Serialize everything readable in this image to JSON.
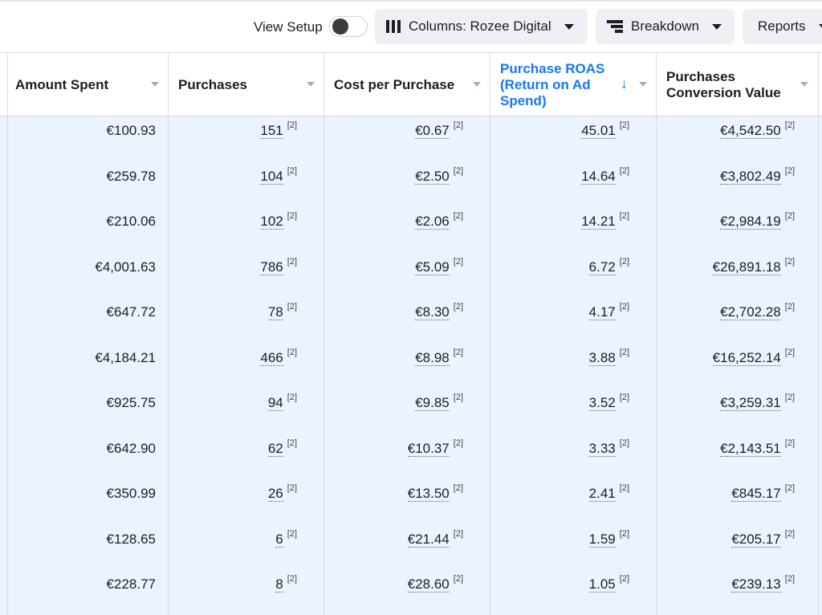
{
  "toolbar": {
    "view_setup_label": "View Setup",
    "view_setup_on": false,
    "columns_label": "Columns: Rozee Digital",
    "breakdown_label": "Breakdown",
    "reports_label": "Reports"
  },
  "table": {
    "columns": [
      {
        "label": "Amount Spent",
        "sorted": false
      },
      {
        "label": "Purchases",
        "sorted": false
      },
      {
        "label": "Cost per Purchase",
        "sorted": false
      },
      {
        "label": "Purchase ROAS (Return on Ad Spend)",
        "sorted": true,
        "sort_direction": "descending"
      },
      {
        "label": "Purchases Conversion Value",
        "sorted": false
      }
    ],
    "footnote": "[2]",
    "rows": [
      {
        "amount_spent": "€100.93",
        "purchases": "151",
        "cost_per_purchase": "€0.67",
        "roas": "45.01",
        "conversion_value": "€4,542.50"
      },
      {
        "amount_spent": "€259.78",
        "purchases": "104",
        "cost_per_purchase": "€2.50",
        "roas": "14.64",
        "conversion_value": "€3,802.49"
      },
      {
        "amount_spent": "€210.06",
        "purchases": "102",
        "cost_per_purchase": "€2.06",
        "roas": "14.21",
        "conversion_value": "€2,984.19"
      },
      {
        "amount_spent": "€4,001.63",
        "purchases": "786",
        "cost_per_purchase": "€5.09",
        "roas": "6.72",
        "conversion_value": "€26,891.18"
      },
      {
        "amount_spent": "€647.72",
        "purchases": "78",
        "cost_per_purchase": "€8.30",
        "roas": "4.17",
        "conversion_value": "€2,702.28"
      },
      {
        "amount_spent": "€4,184.21",
        "purchases": "466",
        "cost_per_purchase": "€8.98",
        "roas": "3.88",
        "conversion_value": "€16,252.14"
      },
      {
        "amount_spent": "€925.75",
        "purchases": "94",
        "cost_per_purchase": "€9.85",
        "roas": "3.52",
        "conversion_value": "€3,259.31"
      },
      {
        "amount_spent": "€642.90",
        "purchases": "62",
        "cost_per_purchase": "€10.37",
        "roas": "3.33",
        "conversion_value": "€2,143.51"
      },
      {
        "amount_spent": "€350.99",
        "purchases": "26",
        "cost_per_purchase": "€13.50",
        "roas": "2.41",
        "conversion_value": "€845.17"
      },
      {
        "amount_spent": "€128.65",
        "purchases": "6",
        "cost_per_purchase": "€21.44",
        "roas": "1.59",
        "conversion_value": "€205.17"
      },
      {
        "amount_spent": "€228.77",
        "purchases": "8",
        "cost_per_purchase": "€28.60",
        "roas": "1.05",
        "conversion_value": "€239.13"
      }
    ]
  }
}
